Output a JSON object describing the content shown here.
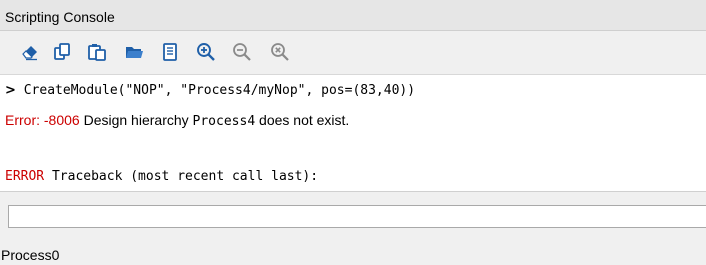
{
  "panel": {
    "title": "Scripting Console"
  },
  "toolbar": {
    "buttons": [
      {
        "icon": "eraser-icon",
        "tooltip": ""
      },
      {
        "icon": "copy-icon",
        "tooltip": ""
      },
      {
        "icon": "paste-icon",
        "tooltip": ""
      },
      {
        "icon": "open-folder-icon",
        "tooltip": ""
      },
      {
        "icon": "script-book-icon",
        "tooltip": ""
      },
      {
        "icon": "zoom-in-icon",
        "tooltip": ""
      },
      {
        "icon": "zoom-out-icon",
        "tooltip": ""
      },
      {
        "icon": "zoom-reset-icon",
        "tooltip": ""
      }
    ],
    "icon_color": "#1f5fa8"
  },
  "console": {
    "prompt": ">",
    "command": " CreateModule(\"NOP\", \"Process4/myNop\", pos=(83,40))",
    "error_label": "Error: -8006",
    "error_text_1": " Design hierarchy ",
    "error_code_term": "Process4",
    "error_text_2": " does not exist.",
    "traceback_keyword": "ERROR",
    "traceback_rest": " Traceback (most recent call last):",
    "error_color": "#cc0000"
  },
  "input": {
    "value": "",
    "placeholder": ""
  },
  "status": {
    "text": "Process0"
  }
}
